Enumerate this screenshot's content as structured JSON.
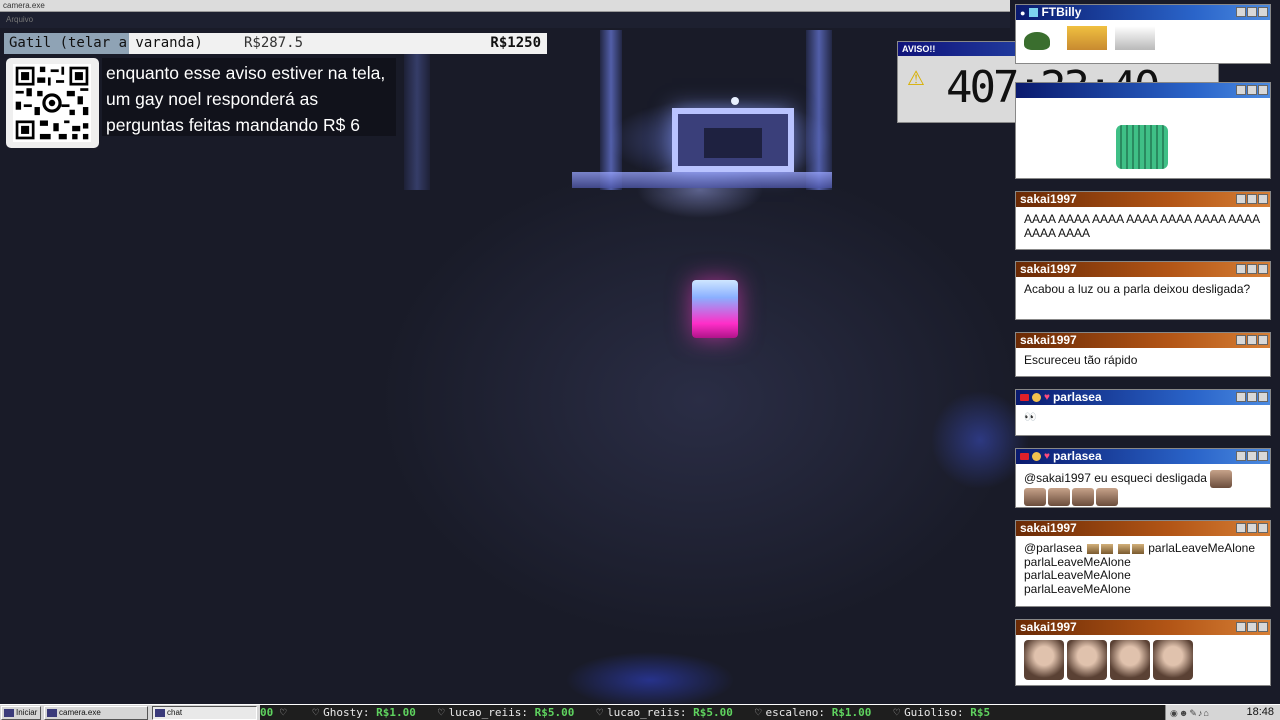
{
  "window": {
    "title": "camera.exe",
    "menu": "Arquivo"
  },
  "goal": {
    "label": "Gatil (telar a varanda)",
    "current": "R$287.5",
    "target": "R$1250",
    "progress": 0.23
  },
  "notice": {
    "text": "enquanto esse aviso estiver na tela, um gay noel responderá as perguntas feitas mandando R$ 6"
  },
  "timer": {
    "title": "AVISO!!",
    "value": "407:23:40",
    "close": "×"
  },
  "chat": {
    "top": {
      "user": "FTBilly"
    },
    "messages": [
      {
        "user": "sakai1997",
        "text": "AAAA AAAA AAAA AAAA AAAA AAAA AAAA AAAA AAAA"
      },
      {
        "user": "sakai1997",
        "text": "Acabou a luz ou a parla deixou desligada?"
      },
      {
        "user": "sakai1997",
        "text": "Escureceu tão rápido"
      },
      {
        "user": "parlasea",
        "text": "👀"
      },
      {
        "user": "parlasea",
        "text": "@sakai1997 eu esqueci desligada"
      },
      {
        "user": "sakai1997",
        "text": "@parlasea",
        "extra": "parlaLeaveMeAlone",
        "lines": [
          "parlaLeaveMeAlone",
          "parlaLeaveMeAlone",
          "parlaLeaveMeAlone"
        ]
      },
      {
        "user": "sakai1997",
        "text": ""
      }
    ]
  },
  "taskbar": {
    "start": "Iniciar",
    "app1": "camera.exe",
    "app2": "chat",
    "ticker": [
      {
        "name": "",
        "amount": "00"
      },
      {
        "name": "Ghosty:",
        "amount": "R$1.00"
      },
      {
        "name": "lucao_reiis:",
        "amount": "R$5.00"
      },
      {
        "name": "lucao_reiis:",
        "amount": "R$5.00"
      },
      {
        "name": "escaleno:",
        "amount": "R$1.00"
      },
      {
        "name": "Guioliso:",
        "amount": "R$5"
      }
    ],
    "clock": "18:48"
  }
}
